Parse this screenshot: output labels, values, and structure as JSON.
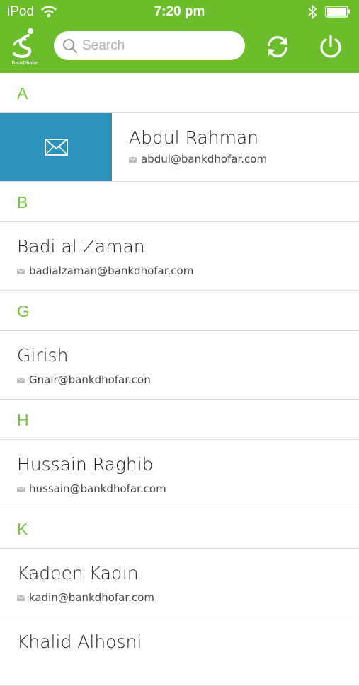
{
  "status_bar": {
    "carrier": "iPod",
    "time": "7:20 pm"
  },
  "header": {
    "logo_text": "BankDhofar",
    "search_placeholder": "Search",
    "colors": {
      "bar": "#6cbd2b",
      "section_letter": "#7ac143",
      "swipe_action": "#2b93bb"
    }
  },
  "contacts": {
    "sections": [
      {
        "letter": "A",
        "entries": [
          {
            "name": "Abdul Rahman",
            "email": "abdul@bankdhofar.com"
          }
        ]
      },
      {
        "letter": "B",
        "entries": [
          {
            "name": "Badi al Zaman",
            "email": "badialzaman@bankdhofar.com"
          }
        ]
      },
      {
        "letter": "G",
        "entries": [
          {
            "name": "Girish",
            "email": "Gnair@bankdhofar.con"
          }
        ]
      },
      {
        "letter": "H",
        "entries": [
          {
            "name": "Hussain Raghib",
            "email": "hussain@bankdhofar.com"
          }
        ]
      },
      {
        "letter": "K",
        "entries": [
          {
            "name": "Kadeen Kadin",
            "email": "kadin@bankdhofar.com"
          },
          {
            "name": "Khalid Alhosni",
            "email": ""
          }
        ]
      }
    ]
  }
}
